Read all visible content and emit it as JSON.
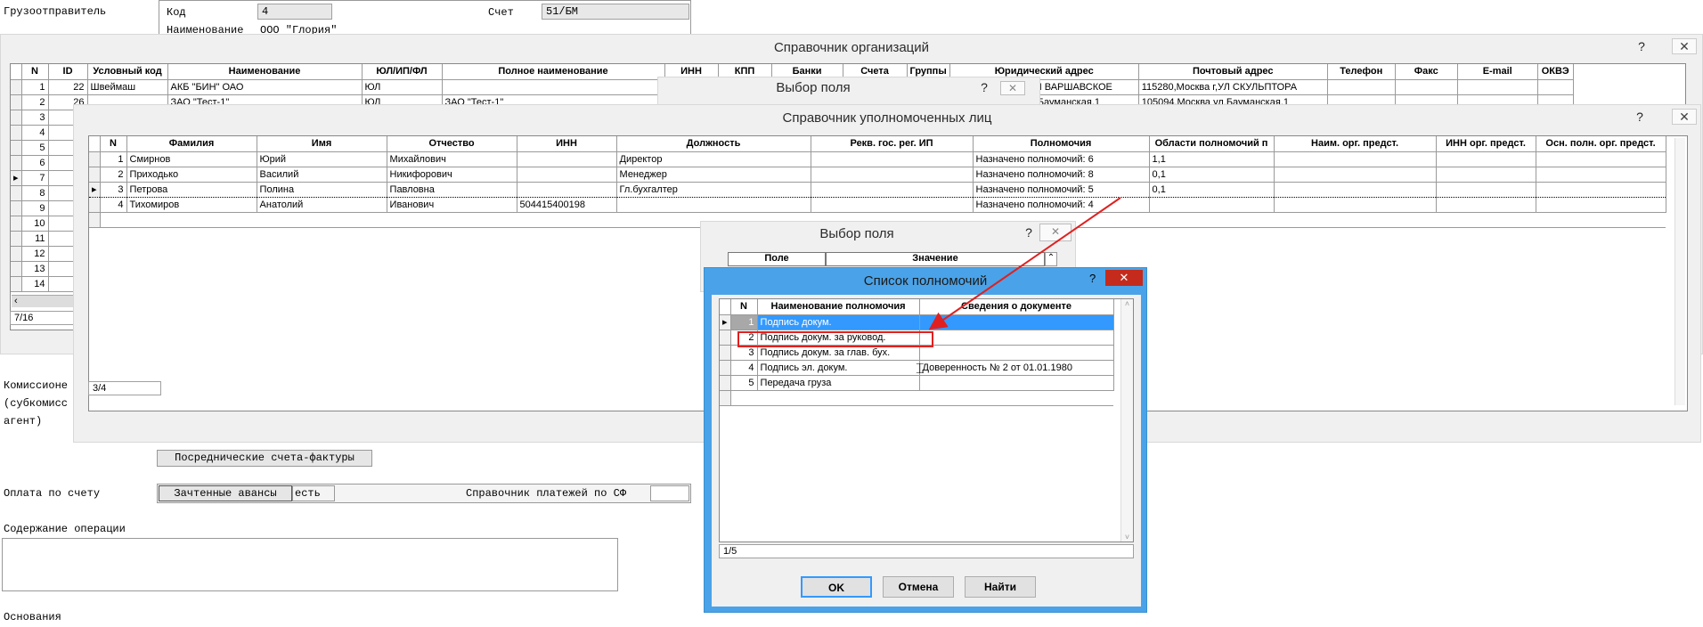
{
  "background_form": {
    "shipper_label": "Грузоотправитель",
    "code_label": "Код",
    "code_value": "4",
    "name_label": "Наименование",
    "name_value": "ООО \"Глория\"",
    "account_label": "Счет",
    "account_value": "51/БМ",
    "commission_line1": "Комиссионе",
    "commission_line2": "(субкомисс",
    "commission_line3": "агент)",
    "intermediary_invoices_button": "Посреднические счета-фактуры",
    "payment_label": "Оплата по счету",
    "offset_advances_label": "Зачтенные авансы",
    "partial_text": "есть",
    "payments_reference_label": "Справочник платежей по СФ",
    "operation_content_label": "Содержание операции",
    "basis_label": "Основания"
  },
  "orgs_window": {
    "title": "Справочник организаций",
    "help": "?",
    "close": "✕",
    "columns": [
      "N",
      "ID",
      "Условный код",
      "Наименование",
      "ЮЛ/ИП/ФЛ",
      "Полное наименование",
      "ИНН",
      "КПП",
      "Банки",
      "Счета",
      "Группы",
      "Юридический адрес",
      "Почтовый адрес",
      "Телефон",
      "Факс",
      "E-mail",
      "ОКВЭ"
    ],
    "row1": {
      "n": "1",
      "id": "22",
      "code": "Швеймаш",
      "name": "АКБ \"БИН\" ОАО",
      "type": "ЮЛ",
      "legal_address": "108852,Москва г,УЛ ВАРШАВСКОЕ",
      "postal_address": "115280,Москва г,УЛ СКУЛЬПТОРА"
    },
    "row2": {
      "n": "2",
      "id": "26",
      "name": "ЗАО \"Тест-1\"",
      "type": "ЮЛ",
      "full_name": "ЗАО \"Тест-1\"",
      "legal_address": "105094,Москва ул.Бауманская,1",
      "postal_address": "105094,Москва ул.Бауманская,1"
    },
    "row_numbers": [
      "3",
      "4",
      "5",
      "6",
      "7",
      "8",
      "9",
      "10",
      "11",
      "12",
      "13",
      "14"
    ],
    "status": "7/16"
  },
  "field_select_1": {
    "title": "Выбор поля",
    "help": "?",
    "close": "✕"
  },
  "persons_window": {
    "title": "Справочник уполномоченных лиц",
    "help": "?",
    "close": "✕",
    "columns": [
      "N",
      "Фамилия",
      "Имя",
      "Отчество",
      "ИНН",
      "Должность",
      "Рекв. гос. рег. ИП",
      "Полномочия",
      "Области полномочий п",
      "Наим. орг. предст.",
      "ИНН орг. предст.",
      "Осн. полн. орг. предст."
    ],
    "rows": [
      {
        "n": "1",
        "last": "Смирнов",
        "first": "Юрий",
        "middle": "Михайлович",
        "inn": "",
        "position": "Директор",
        "powers": "Назначено полномочий: 6",
        "areas": "1,1"
      },
      {
        "n": "2",
        "last": "Приходько",
        "first": "Василий",
        "middle": "Никифорович",
        "inn": "",
        "position": "Менеджер",
        "powers": "Назначено полномочий: 8",
        "areas": "0,1"
      },
      {
        "n": "3",
        "last": "Петрова",
        "first": "Полина",
        "middle": "Павловна",
        "inn": "",
        "position": "Гл.бухгалтер",
        "powers": "Назначено полномочий: 5",
        "areas": "0,1"
      },
      {
        "n": "4",
        "last": "Тихомиров",
        "first": "Анатолий",
        "middle": "Иванович",
        "inn": "504415400198",
        "position": "",
        "powers": "Назначено полномочий: 4",
        "areas": ""
      }
    ],
    "status": "3/4"
  },
  "field_select_2": {
    "title": "Выбор поля",
    "help": "?",
    "close": "✕",
    "col_field": "Поле",
    "col_value": "Значение"
  },
  "powers_dialog": {
    "title": "Список полномочий",
    "help": "?",
    "close": "✕",
    "columns": [
      "N",
      "Наименование полномочия",
      "Сведения о документе"
    ],
    "rows": [
      {
        "n": "1",
        "name": "Подпись докум.",
        "doc": ""
      },
      {
        "n": "2",
        "name": "Подпись докум. за руковод.",
        "doc": ""
      },
      {
        "n": "3",
        "name": "Подпись докум. за глав. бух.",
        "doc": ""
      },
      {
        "n": "4",
        "name": "Подпись эл. докум.",
        "doc": "Доверенность № 2 от 01.01.1980"
      },
      {
        "n": "5",
        "name": "Передача груза",
        "doc": ""
      }
    ],
    "status": "1/5",
    "ok": "OK",
    "cancel": "Отмена",
    "find": "Найти"
  },
  "colors": {
    "selection": "#3399ff",
    "dialog_frame": "#4aa3e8",
    "close_red": "#c42b1c",
    "annotation_red": "#e02020"
  }
}
